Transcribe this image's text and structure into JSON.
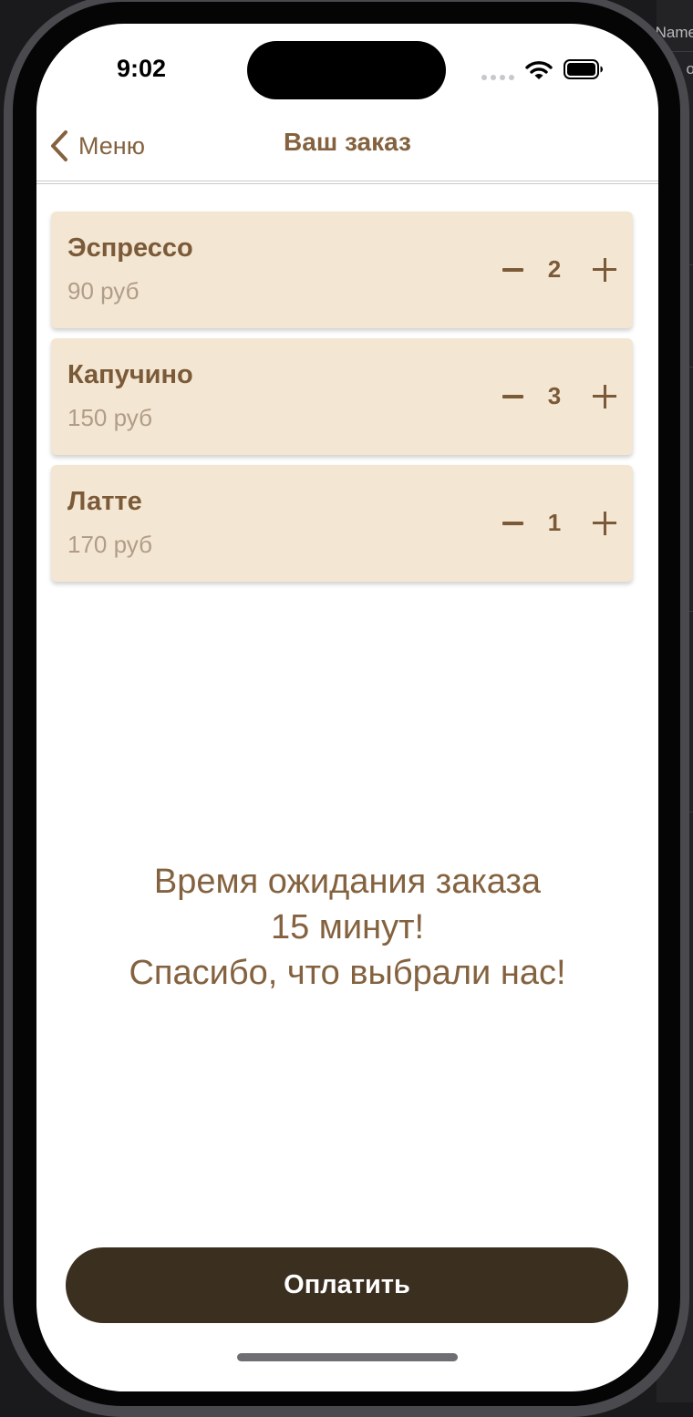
{
  "background_editor": {
    "snippets": [
      "Name",
      "o"
    ]
  },
  "status_bar": {
    "time": "9:02",
    "icons": [
      "signal-dots-icon",
      "wifi-icon",
      "battery-icon"
    ]
  },
  "navbar": {
    "back_label": "Меню",
    "title": "Ваш заказ"
  },
  "order": {
    "items": [
      {
        "name": "Эспрессо",
        "price": "90 руб",
        "quantity": "2"
      },
      {
        "name": "Капучино",
        "price": "150 руб",
        "quantity": "3"
      },
      {
        "name": "Латте",
        "price": "170 руб",
        "quantity": "1"
      }
    ]
  },
  "message": {
    "line1": "Время ожидания заказа",
    "line2": "15 минут!",
    "line3": "Спасибо, что выбрали нас!"
  },
  "pay_button": {
    "label": "Оплатить"
  },
  "colors": {
    "accent_brown": "#84623f",
    "card_bg": "#f3e6d3",
    "button_dark": "#3b2f1f"
  }
}
